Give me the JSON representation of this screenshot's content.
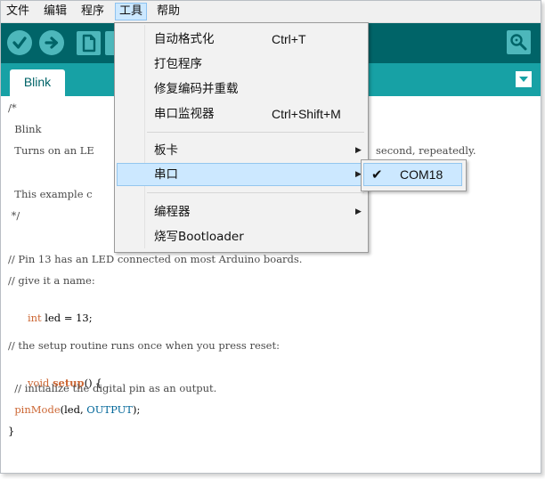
{
  "menubar": {
    "items": [
      {
        "label": "文件"
      },
      {
        "label": "编辑"
      },
      {
        "label": "程序"
      },
      {
        "label": "工具"
      },
      {
        "label": "帮助"
      }
    ]
  },
  "toolbar": {
    "buttons": [
      "verify-icon",
      "upload-icon",
      "new-file-icon",
      "open-icon",
      "save-icon",
      "serial-monitor-icon"
    ]
  },
  "tabs": [
    {
      "label": "Blink"
    }
  ],
  "editor": {
    "lines": [
      {
        "text": "/*"
      },
      {
        "text": "  Blink"
      },
      {
        "text": "  Turns on an LE"
      },
      {
        "text": "second, repeatedly."
      },
      {
        "text": "  This example c"
      },
      {
        "text": " */"
      },
      {
        "text": "// Pin 13 has an LED connected on most Arduino boards."
      },
      {
        "text": "// give it a name:"
      },
      {
        "kw": "int",
        "rest": " led = 13;"
      },
      {
        "text": "// the setup routine runs once when you press reset:"
      },
      {
        "kw": "void",
        "fn": "setup",
        "rest": "() {"
      },
      {
        "text": "  // initialize the digital pin as an output."
      },
      {
        "fn": "pinMode",
        "pre": "(led, ",
        "cst": "OUTPUT",
        "post": ");"
      },
      {
        "text": "}"
      }
    ]
  },
  "tools_menu": {
    "items": [
      {
        "label": "自动格式化",
        "shortcut": "Ctrl+T"
      },
      {
        "label": "打包程序"
      },
      {
        "label": "修复编码并重载"
      },
      {
        "label": "串口监视器",
        "shortcut": "Ctrl+Shift+M"
      },
      {
        "label": "板卡",
        "arrow": "▶"
      },
      {
        "label": "串口",
        "arrow": "▶"
      },
      {
        "label": "编程器",
        "arrow": "▶"
      },
      {
        "label": "烧写Bootloader"
      }
    ]
  },
  "port_submenu": {
    "items": [
      {
        "check": "✔",
        "label": "COM18"
      }
    ]
  },
  "colors": {
    "toolbar": "#006468",
    "tabbar": "#17a1a5",
    "highlight": "#cce8ff"
  }
}
